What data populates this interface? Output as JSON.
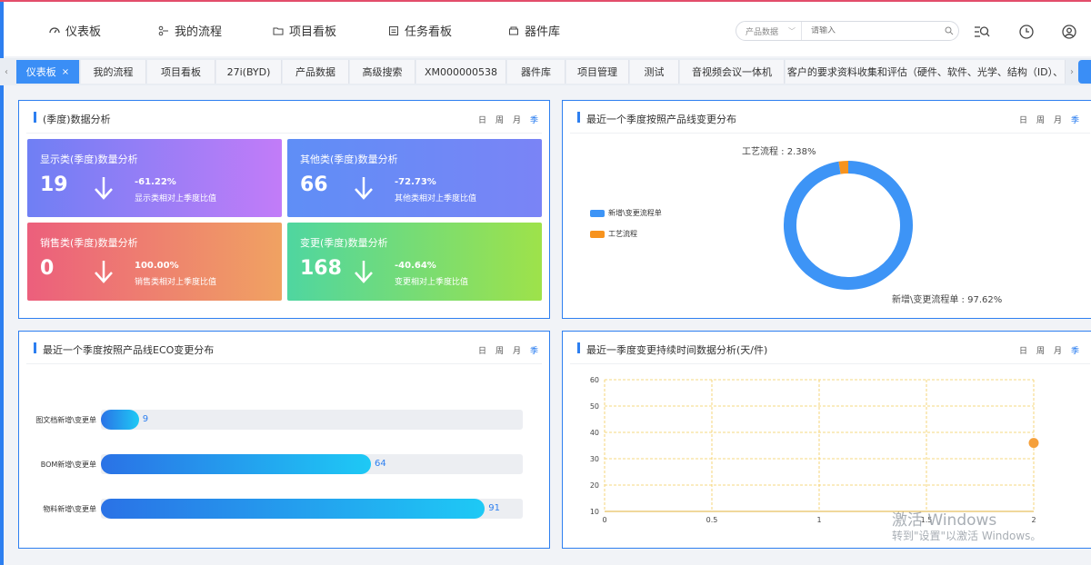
{
  "nav": {
    "items": [
      {
        "label": "仪表板",
        "icon": "dashboard-icon"
      },
      {
        "label": "我的流程",
        "icon": "workflow-icon"
      },
      {
        "label": "项目看板",
        "icon": "folder-icon"
      },
      {
        "label": "任务看板",
        "icon": "task-board-icon"
      },
      {
        "label": "器件库",
        "icon": "component-library-icon"
      }
    ],
    "search": {
      "select_value": "产品数据",
      "placeholder": "请输入"
    }
  },
  "tabs": [
    {
      "label": "仪表板",
      "active": true
    },
    {
      "label": "我的流程"
    },
    {
      "label": "项目看板"
    },
    {
      "label": "27i(BYD)"
    },
    {
      "label": "产品数据"
    },
    {
      "label": "高级搜索"
    },
    {
      "label": "XM000000538"
    },
    {
      "label": "器件库"
    },
    {
      "label": "项目管理"
    },
    {
      "label": "测试"
    },
    {
      "label": "音视频会议一体机"
    },
    {
      "label": "客户的要求资料收集和评估（硬件、软件、光学、结构（ID）、"
    }
  ],
  "period": {
    "day": "日",
    "week": "周",
    "month": "月",
    "quarter": "季"
  },
  "panel1": {
    "title": "(季度)数据分析",
    "cards": [
      {
        "title": "显示类(季度)数量分析",
        "value": "19",
        "pct": "-61.22%",
        "desc": "显示类相对上季度比值"
      },
      {
        "title": "其他类(季度)数量分析",
        "value": "66",
        "pct": "-72.73%",
        "desc": "其他类相对上季度比值"
      },
      {
        "title": "销售类(季度)数量分析",
        "value": "0",
        "pct": "100.00%",
        "desc": "销售类相对上季度比值"
      },
      {
        "title": "变更(季度)数量分析",
        "value": "168",
        "pct": "-40.64%",
        "desc": "变更相对上季度比值"
      }
    ]
  },
  "panel2": {
    "title": "最近一个季度按照产品线变更分布",
    "legend": [
      "新增\\变更流程单",
      "工艺流程"
    ],
    "label_small": "工艺流程 : 2.38%",
    "label_big": "新增\\变更流程单 : 97.62%"
  },
  "panel3": {
    "title": "最近一个季度按照产品线ECO变更分布"
  },
  "panel4": {
    "title": "最近一季度变更持续时间数据分析(天/件)"
  },
  "colors": {
    "accent": "#2d7ff0",
    "donut_main": "#3d94f6",
    "donut_small": "#f7931e"
  },
  "chart_data": [
    {
      "type": "pie",
      "title": "最近一个季度按照产品线变更分布",
      "categories": [
        "新增\\变更流程单",
        "工艺流程"
      ],
      "values": [
        97.62,
        2.38
      ],
      "legend": "left"
    },
    {
      "type": "bar",
      "title": "最近一个季度按照产品线ECO变更分布",
      "categories": [
        "图文档新增\\变更单",
        "BOM新增\\变更单",
        "物料新增\\变更单"
      ],
      "values": [
        9,
        64,
        91
      ],
      "xlim": [
        0,
        100
      ]
    },
    {
      "type": "scatter",
      "title": "最近一季度变更持续时间数据分析(天/件)",
      "x": [
        2
      ],
      "y": [
        36
      ],
      "xlim": [
        0,
        2
      ],
      "ylim": [
        10,
        60
      ],
      "xticks": [
        "0",
        "0.5",
        "1",
        "1.5",
        "2"
      ],
      "yticks": [
        "10",
        "20",
        "30",
        "40",
        "50",
        "60"
      ],
      "grid": true
    }
  ],
  "watermark": {
    "line1": "激活 Windows",
    "line2": "转到\"设置\"以激活 Windows。"
  }
}
